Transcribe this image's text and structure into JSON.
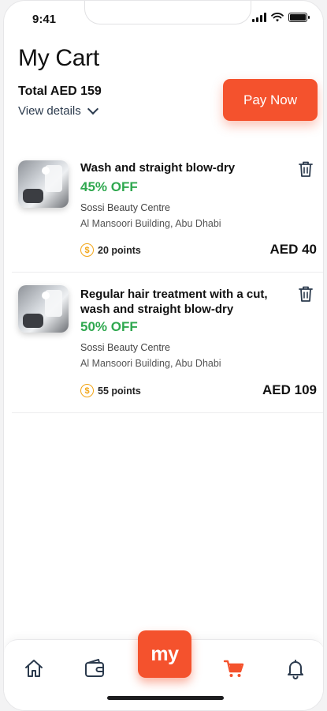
{
  "status_bar": {
    "time": "9:41"
  },
  "header": {
    "title": "My Cart",
    "total_label": "Total AED 159",
    "view_details": "View details",
    "pay_button": "Pay Now"
  },
  "cart": {
    "items": [
      {
        "name": "Wash and straight blow-dry",
        "discount": "45% OFF",
        "vendor": "Sossi Beauty Centre",
        "address": "Al Mansoori Building, Abu Dhabi",
        "points": "20 points",
        "price": "AED 40"
      },
      {
        "name": "Regular hair treatment with a cut, wash and straight blow-dry",
        "discount": "50% OFF",
        "vendor": "Sossi Beauty Centre",
        "address": "Al Mansoori Building, Abu Dhabi",
        "points": "55 points",
        "price": "AED 109"
      }
    ]
  },
  "bottom_nav": {
    "center_label": "my",
    "items": [
      "home-icon",
      "wallet-icon",
      "cart-icon",
      "bell-icon"
    ],
    "active": "cart-icon"
  },
  "colors": {
    "accent": "#f4522d",
    "discount": "#2fa84f",
    "coin": "#f2a516",
    "nav_icon": "#2b3a4d"
  }
}
